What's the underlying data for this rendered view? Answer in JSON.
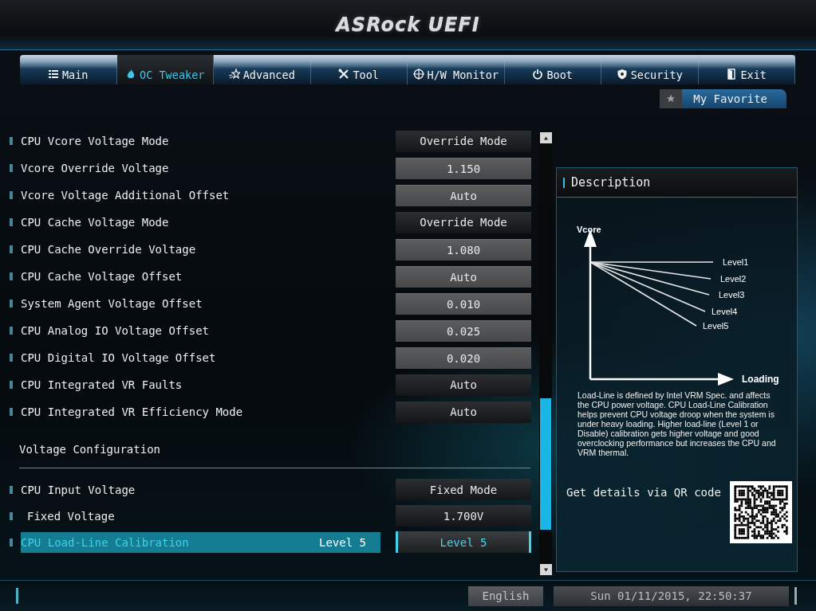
{
  "header": {
    "logo": "ASRock UEFI"
  },
  "tabs": [
    {
      "label": "Main",
      "selected": false
    },
    {
      "label": "OC Tweaker",
      "selected": true
    },
    {
      "label": "Advanced",
      "selected": false
    },
    {
      "label": "Tool",
      "selected": false
    },
    {
      "label": "H/W Monitor",
      "selected": false
    },
    {
      "label": "Boot",
      "selected": false
    },
    {
      "label": "Security",
      "selected": false
    },
    {
      "label": "Exit",
      "selected": false
    }
  ],
  "favorite": {
    "label": "My Favorite"
  },
  "settings": [
    {
      "kind": "dropdown",
      "label": "CPU Vcore Voltage Mode",
      "value": "Override Mode",
      "selected": false
    },
    {
      "kind": "field",
      "label": "Vcore Override Voltage",
      "value": "1.150",
      "selected": false
    },
    {
      "kind": "field",
      "label": "Vcore Voltage Additional Offset",
      "value": "Auto",
      "selected": false
    },
    {
      "kind": "dropdown",
      "label": "CPU Cache Voltage Mode",
      "value": "Override Mode",
      "selected": false
    },
    {
      "kind": "field",
      "label": "CPU Cache Override Voltage",
      "value": "1.080",
      "selected": false
    },
    {
      "kind": "field",
      "label": "CPU Cache Voltage Offset",
      "value": "Auto",
      "selected": false
    },
    {
      "kind": "field",
      "label": "System Agent Voltage Offset",
      "value": "0.010",
      "selected": false
    },
    {
      "kind": "field",
      "label": "CPU Analog IO Voltage Offset",
      "value": "0.025",
      "selected": false
    },
    {
      "kind": "field",
      "label": "CPU Digital IO Voltage Offset",
      "value": "0.020",
      "selected": false
    },
    {
      "kind": "dropdown",
      "label": "CPU Integrated VR Faults",
      "value": "Auto",
      "selected": false
    },
    {
      "kind": "dropdown",
      "label": "CPU Integrated VR Efficiency Mode",
      "value": "Auto",
      "selected": false
    },
    {
      "kind": "heading",
      "label": "Voltage Configuration"
    },
    {
      "kind": "dropdown",
      "label": "CPU Input Voltage",
      "value": "Fixed Mode",
      "selected": false,
      "children": [
        {
          "kind": "dropdown",
          "label": "Fixed Voltage",
          "value": "1.700V",
          "selected": false
        }
      ]
    },
    {
      "kind": "dropdown",
      "label": "CPU Load-Line Calibration",
      "value": "Level 5",
      "inline_value": "Level 5",
      "selected": true
    }
  ],
  "description": {
    "title": "Description",
    "diagram": {
      "y_axis": "Vcore",
      "x_axis": "Loading",
      "lines": [
        "Level1",
        "Level2",
        "Level3",
        "Level4",
        "Level5"
      ]
    },
    "text": "Load-Line is defined by Intel VRM Spec. and affects the CPU power voltage. CPU Load-Line Calibration helps prevent CPU voltage droop when the system is under heavy loading. Higher load-line (Level 1 or Disable) calibration gets higher voltage and good overclocking performance but increases the CPU and VRM thermal.",
    "qr_label": "Get details via QR code"
  },
  "footer": {
    "language": "English",
    "datetime": "Sun 01/11/2015, 22:50:37"
  }
}
